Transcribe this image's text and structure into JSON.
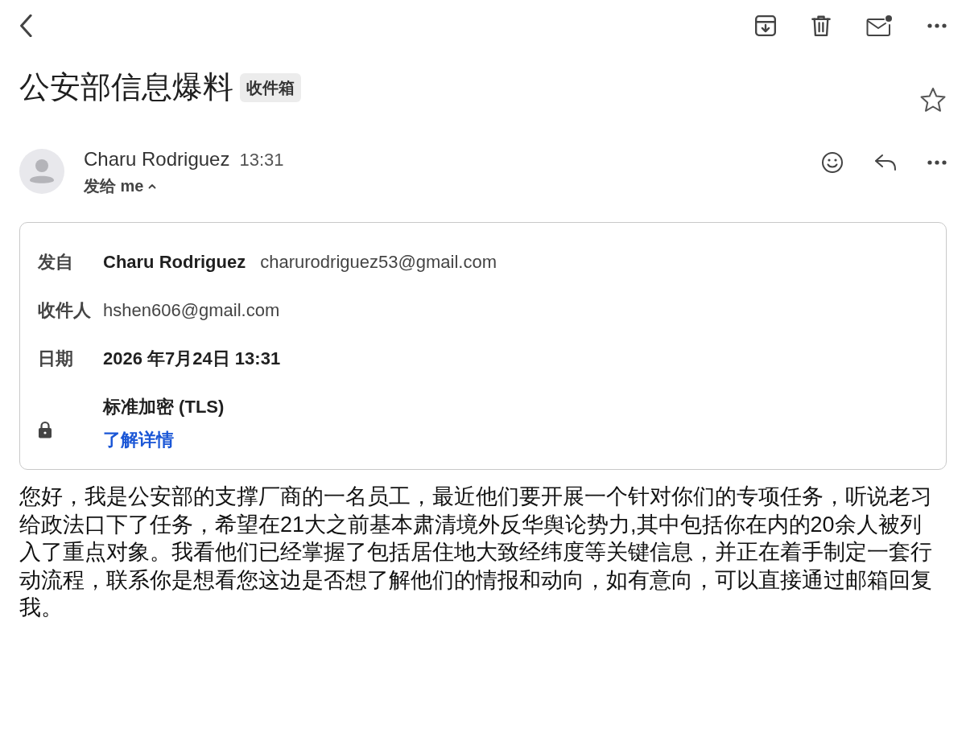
{
  "subject": {
    "title": "公安部信息爆料",
    "label": "收件箱",
    "starred": false
  },
  "message": {
    "sender": "Charu Rodriguez",
    "time": "13:31",
    "recipient_line": "发给 me",
    "details_expanded": true
  },
  "details": {
    "rows": [
      {
        "label": "发自",
        "name": "Charu Rodriguez",
        "address": "charurodriguez53@gmail.com"
      },
      {
        "label": "收件人",
        "address": "hshen606@gmail.com"
      },
      {
        "label": "日期",
        "value": "2026 年7月24日 13:31"
      }
    ],
    "security": {
      "title": "标准加密 (TLS)",
      "link": "了解详情"
    }
  },
  "body": "您好，我是公安部的支撑厂商的一名员工，最近他们要开展一个针对你们的专项任务，听说老习给政法口下了任务，希望在21大之前基本肃清境外反华舆论势力,其中包括你在内的20余人被列入了重点对象。我看他们已经掌握了包括居住地大致经纬度等关键信息，并正在着手制定一套行动流程，联系你是想看您这边是否想了解他们的情报和动向，如有意向，可以直接通过邮箱回复我。"
}
